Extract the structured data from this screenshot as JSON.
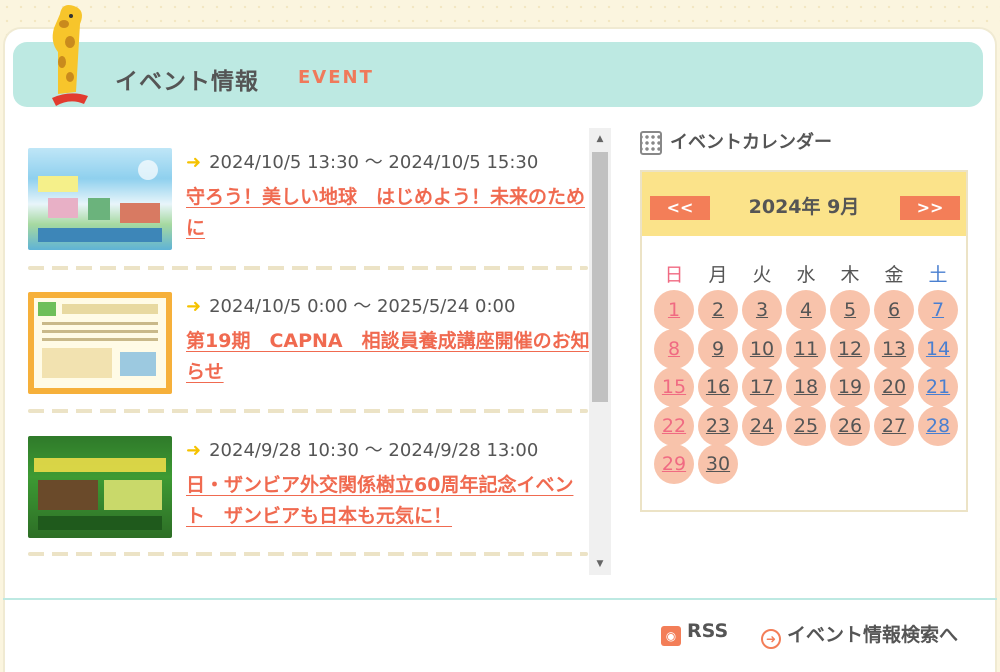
{
  "section": {
    "title": "イベント情報",
    "title_en": "EVENT"
  },
  "events": [
    {
      "date": "2024/10/5 13:30 ～ 2024/10/5 15:30",
      "title": "守ろう！美しい地球　はじめよう！未来のために"
    },
    {
      "date": "2024/10/5 0:00 ～ 2025/5/24 0:00",
      "title": "第19期　CAPNA　相談員養成講座開催のお知らせ"
    },
    {
      "date": "2024/9/28 10:30 ～ 2024/9/28 13:00",
      "title": "日・ザンビア外交関係樹立60周年記念イベント　ザンビアも日本も元気に！"
    }
  ],
  "calendar": {
    "heading": "イベントカレンダー",
    "prev": "<<",
    "next": ">>",
    "month": "2024年 9月",
    "weekdays": [
      "日",
      "月",
      "火",
      "水",
      "木",
      "金",
      "土"
    ],
    "days": [
      "1",
      "2",
      "3",
      "4",
      "5",
      "6",
      "7",
      "8",
      "9",
      "10",
      "11",
      "12",
      "13",
      "14",
      "15",
      "16",
      "17",
      "18",
      "19",
      "20",
      "21",
      "22",
      "23",
      "24",
      "25",
      "26",
      "27",
      "28",
      "29",
      "30"
    ]
  },
  "footer": {
    "rss": "RSS",
    "search": "イベント情報検索へ"
  },
  "colors": {
    "accent": "#f06a50",
    "header_bg": "#bde9e2",
    "calendar_bar": "#fbe38a",
    "day_circle": "#f8c3ab"
  }
}
